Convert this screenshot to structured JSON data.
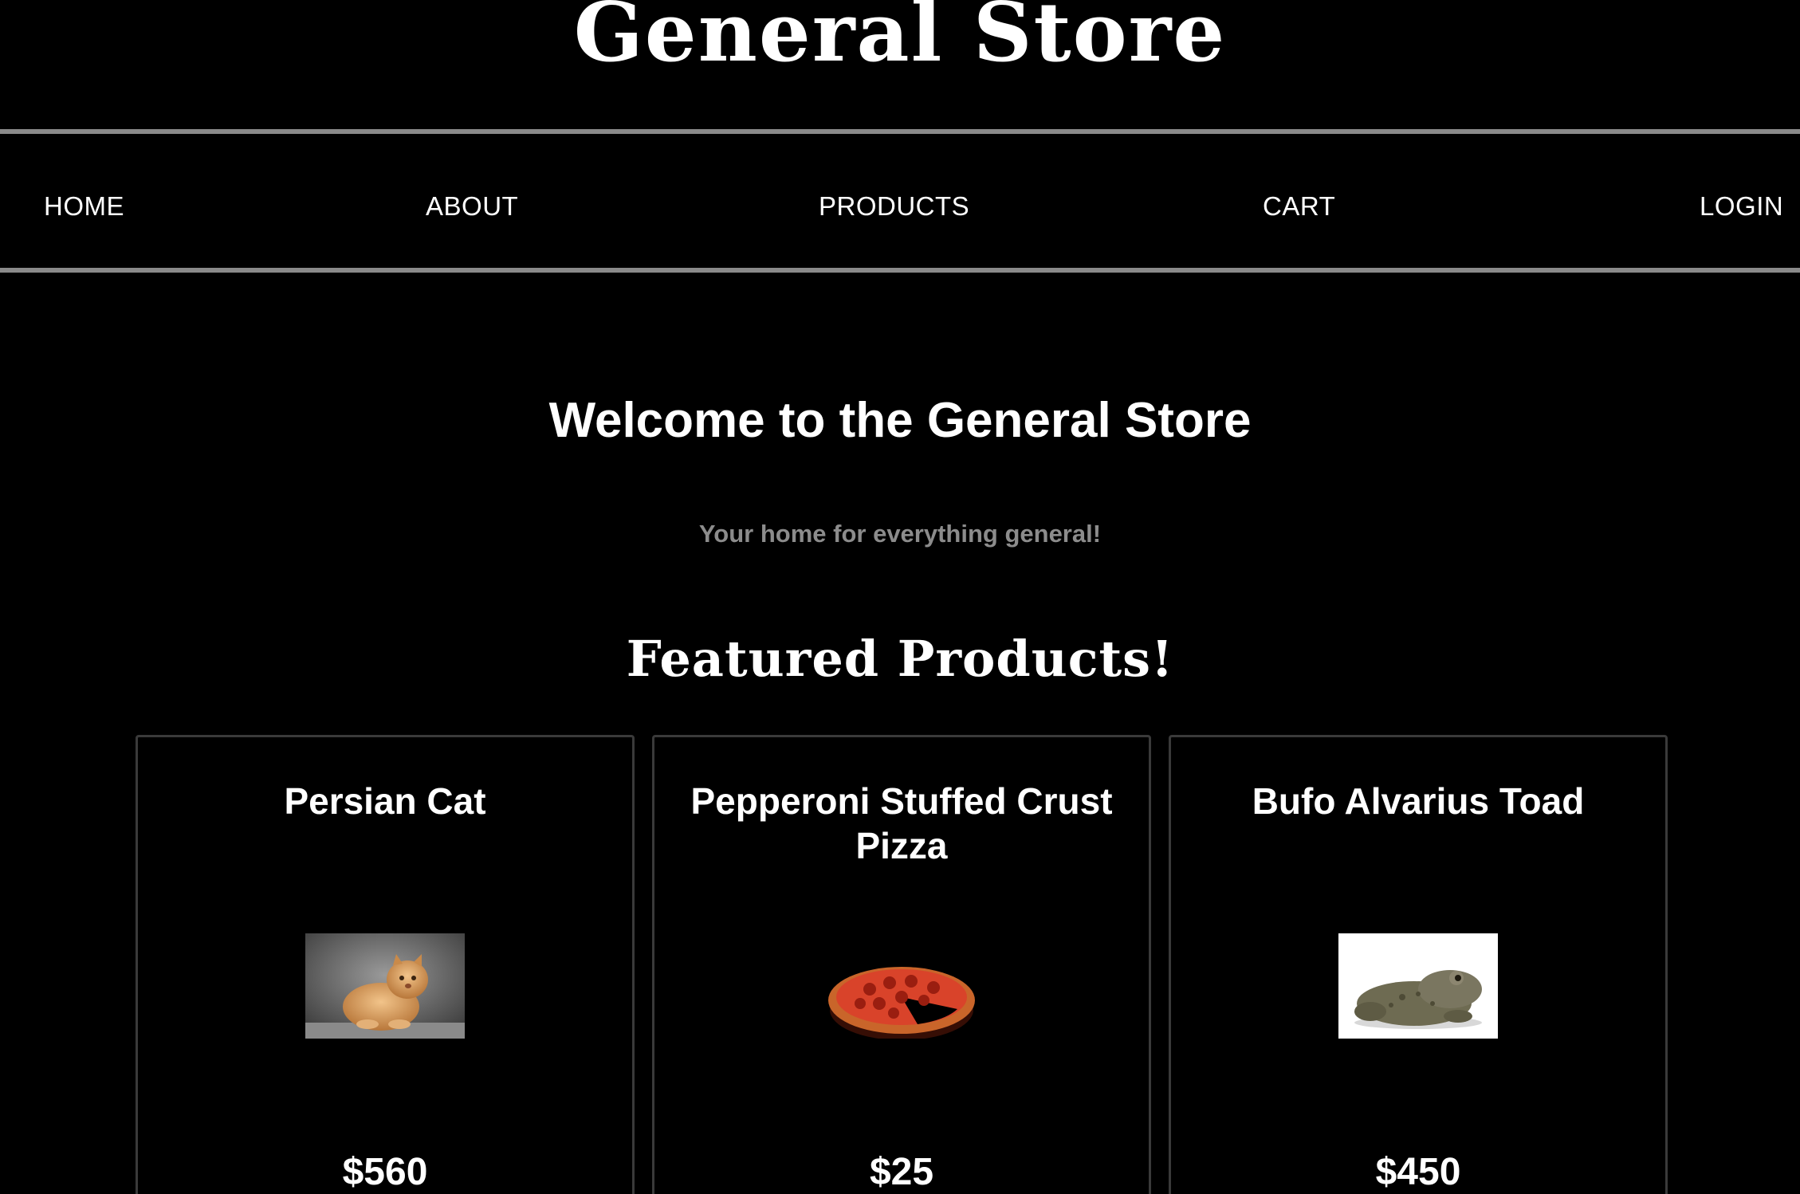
{
  "site": {
    "title": "General Store"
  },
  "nav": {
    "items": [
      {
        "label": "HOME"
      },
      {
        "label": "ABOUT"
      },
      {
        "label": "PRODUCTS"
      },
      {
        "label": "CART"
      },
      {
        "label": "LOGIN"
      }
    ]
  },
  "hero": {
    "heading": "Welcome to the General Store",
    "tagline": "Your home for everything general!"
  },
  "featured": {
    "heading": "Featured Products!",
    "products": [
      {
        "name": "Persian Cat",
        "price": "$560",
        "image_alt": "persian-cat-photo"
      },
      {
        "name": "Pepperoni Stuffed Crust Pizza",
        "price": "$25",
        "image_alt": "pepperoni-pizza-photo"
      },
      {
        "name": "Bufo Alvarius Toad",
        "price": "$450",
        "image_alt": "toad-photo"
      }
    ]
  },
  "colors": {
    "background": "#000000",
    "text": "#ffffff",
    "muted_text": "#8c8c8c",
    "nav_border": "#8a8a8a",
    "card_border": "#3a3a3a"
  }
}
